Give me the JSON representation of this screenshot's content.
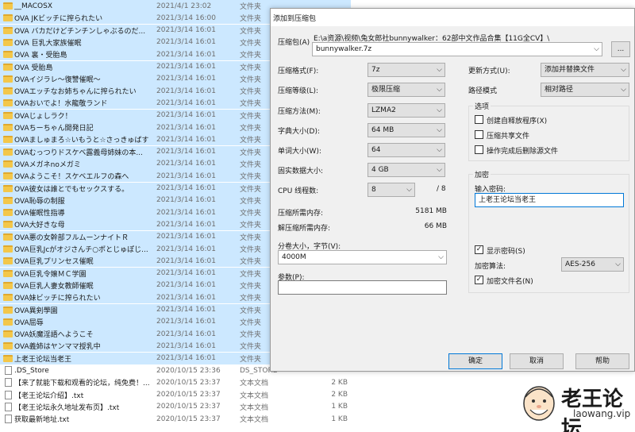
{
  "explorer": {
    "rows": [
      {
        "name": "__MACOSX",
        "date": "2021/4/1 23:02",
        "type": "文件夹",
        "size": "",
        "kind": "folder"
      },
      {
        "name": "OVA JKビッチに搾られたい",
        "date": "2021/3/14 16:00",
        "type": "文件夹",
        "size": "",
        "kind": "folder"
      },
      {
        "name": "OVA バカだけどチンチンしゃぶるのだ...",
        "date": "2021/3/14 16:01",
        "type": "文件夹",
        "size": "",
        "kind": "folder"
      },
      {
        "name": "OVA 巨乳大家族催眠",
        "date": "2021/3/14 16:01",
        "type": "文件夹",
        "size": "",
        "kind": "folder"
      },
      {
        "name": "OVA 裏・受胎島",
        "date": "2021/3/14 16:01",
        "type": "文件夹",
        "size": "",
        "kind": "folder"
      },
      {
        "name": "OVA 受胎島",
        "date": "2021/3/14 16:01",
        "type": "文件夹",
        "size": "",
        "kind": "folder"
      },
      {
        "name": "OVAイジラレ～復讐催眠～",
        "date": "2021/3/14 16:01",
        "type": "文件夹",
        "size": "",
        "kind": "folder"
      },
      {
        "name": "OVAエッチなお姉ちゃんに搾られたい",
        "date": "2021/3/14 16:01",
        "type": "文件夹",
        "size": "",
        "kind": "folder"
      },
      {
        "name": "OVAおいでよ！水龍敬ランド",
        "date": "2021/3/14 16:01",
        "type": "文件夹",
        "size": "",
        "kind": "folder"
      },
      {
        "name": "OVAじょしラク！",
        "date": "2021/3/14 16:01",
        "type": "文件夹",
        "size": "",
        "kind": "folder"
      },
      {
        "name": "OVAちーちゃん開発日記",
        "date": "2021/3/14 16:01",
        "type": "文件夹",
        "size": "",
        "kind": "folder"
      },
      {
        "name": "OVAましゅまろ☆いもうと☆さっきゅばす",
        "date": "2021/3/14 16:01",
        "type": "文件夹",
        "size": "",
        "kind": "folder"
      },
      {
        "name": "OVAむっつりドスケベ露義母姉妹の本...",
        "date": "2021/3/14 16:01",
        "type": "文件夹",
        "size": "",
        "kind": "folder"
      },
      {
        "name": "OVAメガネnoメガミ",
        "date": "2021/3/14 16:01",
        "type": "文件夹",
        "size": "",
        "kind": "folder"
      },
      {
        "name": "OVAようこそ！スケベエルフの森へ",
        "date": "2021/3/14 16:01",
        "type": "文件夹",
        "size": "",
        "kind": "folder"
      },
      {
        "name": "OVA彼女は誰とでもセックスする。",
        "date": "2021/3/14 16:01",
        "type": "文件夹",
        "size": "",
        "kind": "folder"
      },
      {
        "name": "OVA恥辱の制服",
        "date": "2021/3/14 16:01",
        "type": "文件夹",
        "size": "",
        "kind": "folder"
      },
      {
        "name": "OVA催眠性指導",
        "date": "2021/3/14 16:01",
        "type": "文件夹",
        "size": "",
        "kind": "folder"
      },
      {
        "name": "OVA大好きな母",
        "date": "2021/3/14 16:01",
        "type": "文件夹",
        "size": "",
        "kind": "folder"
      },
      {
        "name": "OVA悪の女幹部フルムーンナイトＲ",
        "date": "2021/3/14 16:01",
        "type": "文件夹",
        "size": "",
        "kind": "folder"
      },
      {
        "name": "OVA巨乳Jcがオジさんチ○ポとじゅぽじ...",
        "date": "2021/3/14 16:01",
        "type": "文件夹",
        "size": "",
        "kind": "folder"
      },
      {
        "name": "OVA巨乳プリンセス催眠",
        "date": "2021/3/14 16:01",
        "type": "文件夹",
        "size": "",
        "kind": "folder"
      },
      {
        "name": "OVA巨乳令嬢ＭＣ学園",
        "date": "2021/3/14 16:01",
        "type": "文件夹",
        "size": "",
        "kind": "folder"
      },
      {
        "name": "OVA巨乳人妻女教師催眠",
        "date": "2021/3/14 16:01",
        "type": "文件夹",
        "size": "",
        "kind": "folder"
      },
      {
        "name": "OVA妹ビッチに搾られたい",
        "date": "2021/3/14 16:01",
        "type": "文件夹",
        "size": "",
        "kind": "folder"
      },
      {
        "name": "OVA異剣學園",
        "date": "2021/3/14 16:01",
        "type": "文件夹",
        "size": "",
        "kind": "folder"
      },
      {
        "name": "OVA屈辱",
        "date": "2021/3/14 16:01",
        "type": "文件夹",
        "size": "",
        "kind": "folder"
      },
      {
        "name": "OVA妖魔淫語へようこそ",
        "date": "2021/3/14 16:01",
        "type": "文件夹",
        "size": "",
        "kind": "folder"
      },
      {
        "name": "OVA義姉はヤンママ授乳中",
        "date": "2021/3/14 16:01",
        "type": "文件夹",
        "size": "",
        "kind": "folder"
      },
      {
        "name": "上老王论坛当老王",
        "date": "2021/3/14 16:01",
        "type": "文件夹",
        "size": "",
        "kind": "folder"
      },
      {
        "name": ".DS_Store",
        "date": "2020/10/15 23:36",
        "type": "DS_STORE",
        "size": "",
        "kind": "file"
      },
      {
        "name": "【来了就能下载和观看的论坛，纯免费！...",
        "date": "2020/10/15 23:37",
        "type": "文本文档",
        "size": "2 KB",
        "kind": "file"
      },
      {
        "name": "【老王论坛介绍】.txt",
        "date": "2020/10/15 23:37",
        "type": "文本文档",
        "size": "2 KB",
        "kind": "file"
      },
      {
        "name": "【老王论坛永久地址发布页】.txt",
        "date": "2020/10/15 23:37",
        "type": "文本文档",
        "size": "1 KB",
        "kind": "file"
      },
      {
        "name": "获取最新地址.txt",
        "date": "2020/10/15 23:37",
        "type": "文本文档",
        "size": "1 KB",
        "kind": "file"
      }
    ]
  },
  "dialog": {
    "title": "添加到压缩包",
    "archive": {
      "label": "压缩包(A)",
      "path": "E:\\a资源\\视频\\兔女郎社bunnywalker：62部中文作品合集【11G全CV】\\",
      "value": "bunnywalker.7z",
      "browse_label": "..."
    },
    "left": {
      "format": {
        "label": "压缩格式(F):",
        "value": "7z"
      },
      "level": {
        "label": "压缩等级(L):",
        "value": "极限压缩"
      },
      "method": {
        "label": "压缩方法(M):",
        "value": "LZMA2"
      },
      "dict": {
        "label": "字典大小(D):",
        "value": "64 MB"
      },
      "word": {
        "label": "单词大小(W):",
        "value": "64"
      },
      "solid": {
        "label": "固实数据大小:",
        "value": "4 GB"
      },
      "threads": {
        "label": "CPU 线程数:",
        "value": "8",
        "max": "/ 8"
      },
      "mem_compress": {
        "label": "压缩所需内存:",
        "value": "5181 MB"
      },
      "mem_decompress": {
        "label": "解压缩所需内存:",
        "value": "66 MB"
      },
      "split": {
        "label": "分卷大小，字节(V):",
        "value": "4000M"
      },
      "params": {
        "label": "参数(P):",
        "value": ""
      }
    },
    "right": {
      "update": {
        "label": "更新方式(U):",
        "value": "添加并替换文件"
      },
      "pathmode": {
        "label": "路径模式",
        "value": "相对路径"
      },
      "options": {
        "legend": "选项",
        "sfx": {
          "label": "创建自释放程序(X)",
          "checked": false
        },
        "shared": {
          "label": "压缩共享文件",
          "checked": false
        },
        "delete": {
          "label": "操作完成后删除源文件",
          "checked": false
        }
      },
      "encryption": {
        "legend": "加密",
        "password_label": "输入密码:",
        "password_value": "上老王论坛当老王",
        "show_password": {
          "label": "显示密码(S)",
          "checked": true
        },
        "method_label": "加密算法:",
        "method_value": "AES-256",
        "encrypt_names": {
          "label": "加密文件名(N)",
          "checked": true
        }
      }
    },
    "buttons": {
      "ok": "确定",
      "cancel": "取消",
      "help": "帮助"
    }
  },
  "watermark": {
    "brand": "老王论坛",
    "url": "laowang.vip"
  },
  "colors": {
    "selection": "#cce8ff",
    "folder": "#f3c74a",
    "accent": "#0078d7",
    "dialog_bg": "#f0f0f0"
  }
}
